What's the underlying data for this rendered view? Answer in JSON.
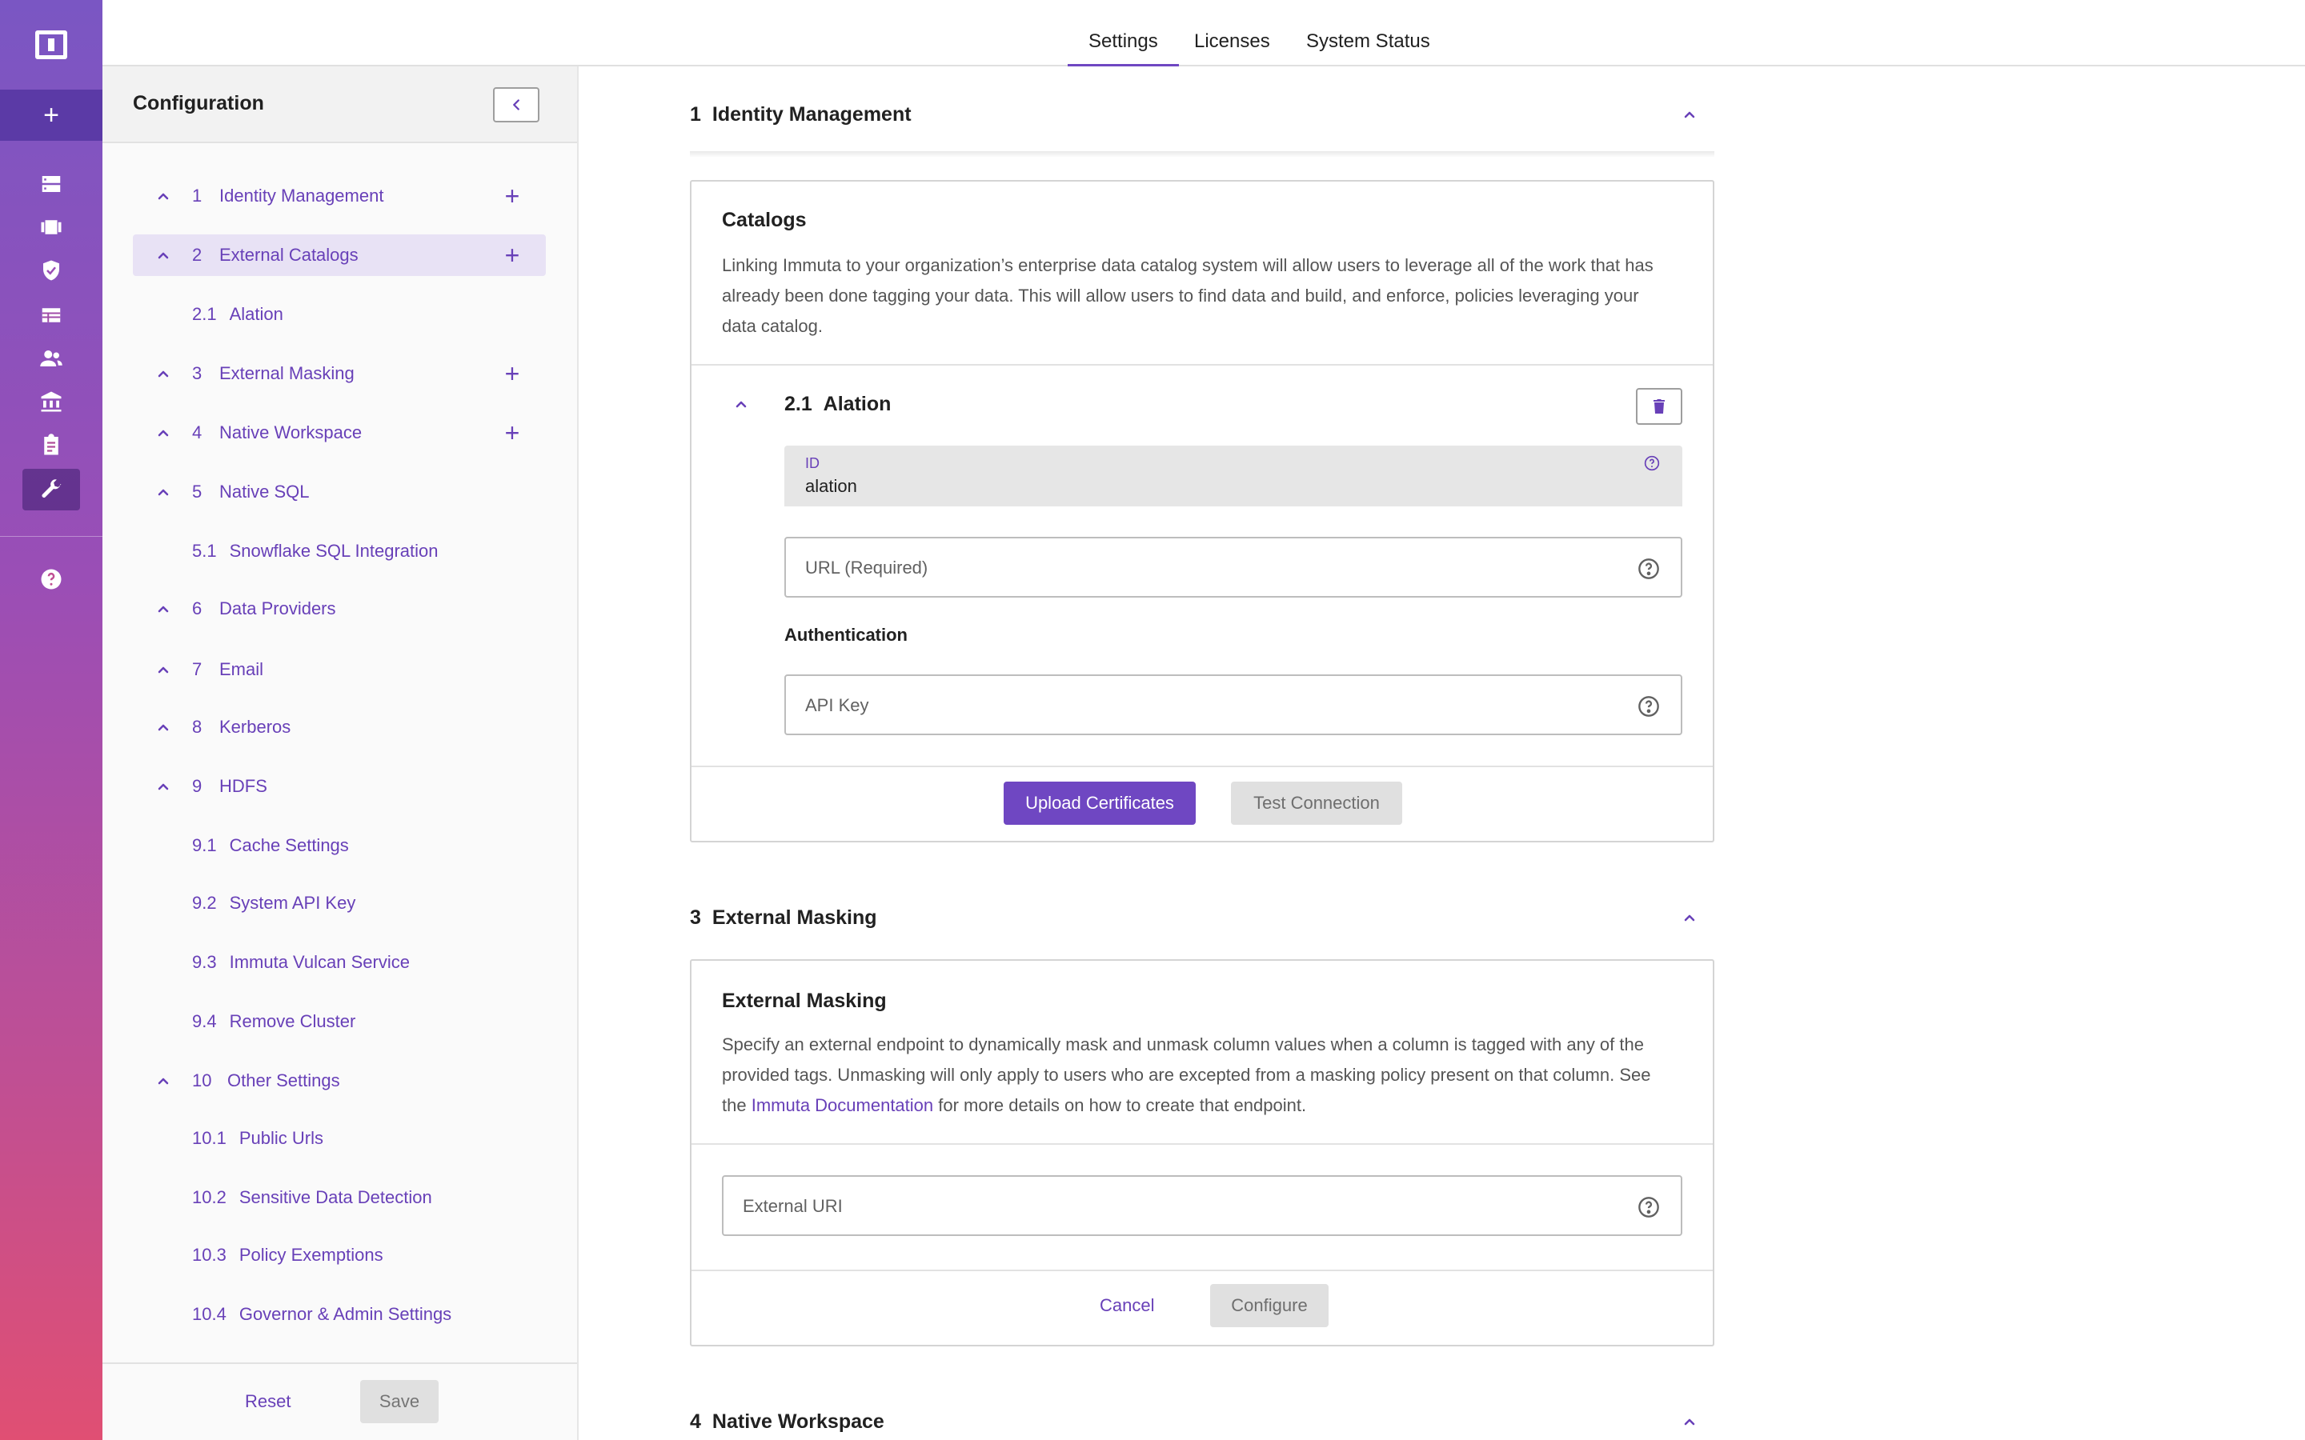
{
  "top_tabs": [
    "Settings",
    "Licenses",
    "System Status"
  ],
  "rail": {
    "icons": [
      "logo-icon",
      "add-icon",
      "servers-icon",
      "projects-icon",
      "policies-icon",
      "data-sources-icon",
      "people-icon",
      "governance-icon",
      "audit-icon",
      "settings-wrench-icon",
      "help-icon"
    ],
    "colors": {
      "gradient_top": "#7a56c3",
      "gradient_bottom": "#e04f73",
      "accent": "#6f47c2"
    }
  },
  "config": {
    "title": "Configuration",
    "items": [
      {
        "num": "1",
        "label": "Identity Management",
        "addable": true,
        "children": []
      },
      {
        "num": "2",
        "label": "External Catalogs",
        "addable": true,
        "selected": true,
        "children": [
          {
            "num": "2.1",
            "label": "Alation"
          }
        ]
      },
      {
        "num": "3",
        "label": "External Masking",
        "addable": true,
        "children": []
      },
      {
        "num": "4",
        "label": "Native Workspace",
        "addable": true,
        "children": []
      },
      {
        "num": "5",
        "label": "Native SQL",
        "children": [
          {
            "num": "5.1",
            "label": "Snowflake SQL Integration"
          }
        ]
      },
      {
        "num": "6",
        "label": "Data Providers",
        "children": []
      },
      {
        "num": "7",
        "label": "Email",
        "children": []
      },
      {
        "num": "8",
        "label": "Kerberos",
        "children": []
      },
      {
        "num": "9",
        "label": "HDFS",
        "children": [
          {
            "num": "9.1",
            "label": "Cache Settings"
          },
          {
            "num": "9.2",
            "label": "System API Key"
          },
          {
            "num": "9.3",
            "label": "Immuta Vulcan Service"
          },
          {
            "num": "9.4",
            "label": "Remove Cluster"
          }
        ]
      },
      {
        "num": "10",
        "label": "Other Settings",
        "children": [
          {
            "num": "10.1",
            "label": "Public Urls"
          },
          {
            "num": "10.2",
            "label": "Sensitive Data Detection"
          },
          {
            "num": "10.3",
            "label": "Policy Exemptions"
          },
          {
            "num": "10.4",
            "label": "Governor & Admin Settings"
          }
        ]
      }
    ],
    "reset_label": "Reset",
    "save_label": "Save"
  },
  "main": {
    "section1": {
      "num": "1",
      "title": "Identity Management"
    },
    "catalogs": {
      "title": "Catalogs",
      "desc_line1": "Linking Immuta to your organization’s enterprise data catalog system will allow users to leverage all of the work that has",
      "desc_line2": "already been done tagging your data. This will allow users to find data and build, and enforce, policies leveraging your",
      "desc_line3": "data catalog.",
      "sub": {
        "num": "2.1",
        "title": "Alation"
      },
      "id_label": "ID",
      "id_value": "alation",
      "url_placeholder": "URL (Required)",
      "auth_label": "Authentication",
      "api_key_placeholder": "API Key",
      "upload_label": "Upload Certificates",
      "test_label": "Test Connection"
    },
    "section3": {
      "num": "3",
      "title": "External Masking"
    },
    "masking": {
      "title": "External Masking",
      "desc_line1": "Specify an external endpoint to dynamically mask and unmask column values when a column is tagged with any of the",
      "desc_line2": "provided tags. Unmasking will only apply to users who are excepted from a masking policy present on that column. See",
      "desc_line3_pre": "the ",
      "desc_link": "Immuta Documentation",
      "desc_line3_post": " for more details on how to create that endpoint.",
      "uri_placeholder": "External URI",
      "cancel_label": "Cancel",
      "configure_label": "Configure"
    },
    "section4": {
      "num": "4",
      "title": "Native Workspace"
    }
  }
}
